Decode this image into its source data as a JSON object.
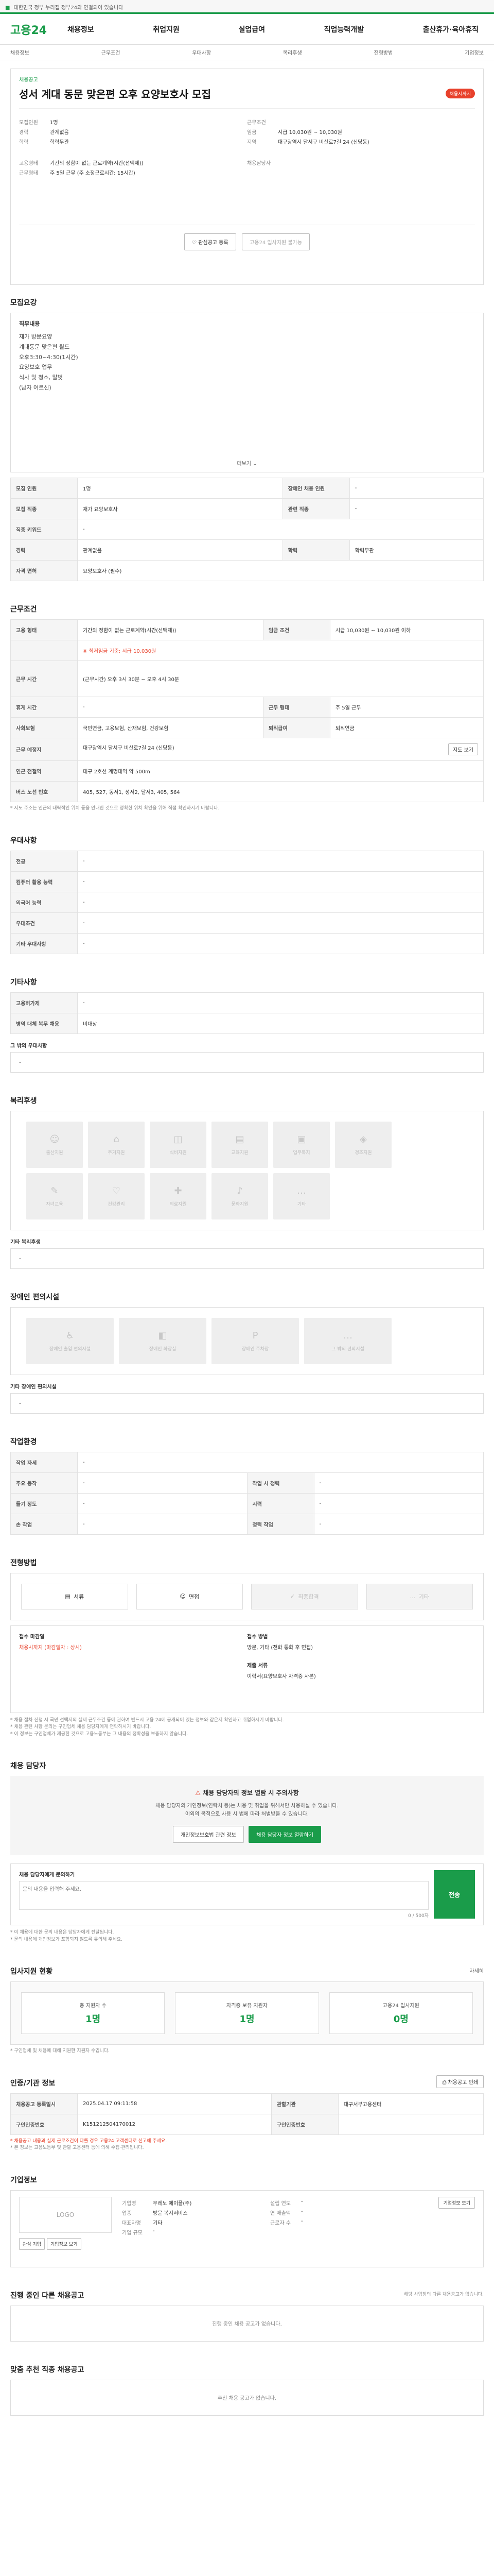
{
  "topbar": {
    "text": "대한민국 정부 누리집 정부24와 연결되어 있습니다"
  },
  "header": {
    "logo": "고용24",
    "nav": [
      "채용정보",
      "취업지원",
      "실업급여",
      "직업능력개발",
      "출산휴가·육아휴직"
    ]
  },
  "subnav": [
    "채용정보",
    "근무조건",
    "우대사항",
    "복리후생",
    "전형방법",
    "기업정보"
  ],
  "job": {
    "type_label": "채용공고",
    "title": "성서 계대 동문 맞은편 오후 요양보호사 모집",
    "status_badge": "채용시까지",
    "left": [
      {
        "k": "모집인원",
        "v": "1명"
      },
      {
        "k": "경력",
        "v": "관계없음"
      },
      {
        "k": "학력",
        "v": "학력무관"
      }
    ],
    "right": [
      {
        "k": "근무조건",
        "v": ""
      },
      {
        "k": "임금",
        "v": "시급 10,030원 ~ 10,030원"
      },
      {
        "k": "지역",
        "v": "대구광역시 달서구 비산로7길 24 (신당동)"
      }
    ],
    "employment": [
      {
        "k": "고용형태",
        "v": "기간의 정함이 없는 근로계약(시간(선택제))"
      },
      {
        "k": "근무형태",
        "v": "주 5일 근무 (주 소정근로시간: 15시간)"
      }
    ],
    "contact_label": "채용담당자",
    "interest_btn": "관심공고 등록",
    "share_btn": "고용24 입사지원 불가능"
  },
  "recruit": {
    "title": "모집요강",
    "desc_title": "직무내용",
    "desc_lines": [
      "재가 방문요양",
      "계대동문 맞은편 월드",
      "오후3:30~4:30(1시간)",
      "요양보호 업무",
      "식사 및 청소, 말벗",
      "(남자 어르신)"
    ],
    "more": "더보기",
    "rows": [
      {
        "k": "모집 인원",
        "v": "1명",
        "k2": "장애인 채용 인원",
        "v2": "-"
      },
      {
        "k": "모집 직종",
        "v": "재가 요양보호사",
        "k2": "관련 직종",
        "v2": "-"
      },
      {
        "k": "직종 키워드",
        "v": "-",
        "k2": "",
        "v2": ""
      },
      {
        "k": "경력",
        "v": "관계없음",
        "k2": "학력",
        "v2": "학력무관"
      },
      {
        "k": "자격 면허",
        "v": "요양보호사 (필수)",
        "k2": "",
        "v2": ""
      }
    ]
  },
  "conditions": {
    "title": "근무조건",
    "rows": [
      {
        "k": "고용 형태",
        "v": "기간의 정함이 없는 근로계약(시간(선택제))",
        "k2": "임금 조건",
        "v2": "시급 10,030원 ~ 10,030원 이하"
      },
      {
        "k": "",
        "v": "※ 최저임금 기준: 시급 10,030원",
        "k2": "",
        "v2": ""
      },
      {
        "k": "근무 시간",
        "v": "(근무시간) 오후 3시 30분 ~ 오후 4시 30분",
        "k2": "",
        "v2": ""
      },
      {
        "k": "휴게 시간",
        "v": "-",
        "k2": "근무 형태",
        "v2": "주 5일 근무"
      },
      {
        "k": "사회보험",
        "v": "국민연금, 고용보험, 산재보험, 건강보험",
        "k2": "퇴직급여",
        "v2": "퇴직연금"
      },
      {
        "k": "근무 예정지",
        "v": "대구광역시 달서구 비산로7길 24 (신당동)",
        "k2": "",
        "v2": ""
      },
      {
        "k": "인근 전철역",
        "v": "대구 2호선 계명대역 약 500m",
        "k2": "",
        "v2": ""
      },
      {
        "k": "버스 노선 번호",
        "v": "405, 527, 동서1, 성서2, 달서3, 405, 564",
        "k2": "",
        "v2": ""
      }
    ],
    "map_btn": "지도 보기",
    "note": "* 지도 주소는 인근의 대략적인 위치 등을 안내한 것으로 정확한 위치 확인을 위해 직접 확인하시기 바랍니다."
  },
  "preference": {
    "title": "우대사항",
    "rows": [
      {
        "k": "전공",
        "v": "-"
      },
      {
        "k": "컴퓨터 활용 능력",
        "v": "-"
      },
      {
        "k": "외국어 능력",
        "v": "-"
      },
      {
        "k": "우대조건",
        "v": "-"
      },
      {
        "k": "기타 우대사항",
        "v": "-"
      }
    ]
  },
  "etc": {
    "title": "기타사항",
    "rows": [
      {
        "k": "고용허가제",
        "v": "-"
      },
      {
        "k": "병역 대체 복무 채용",
        "v": "비대상"
      }
    ],
    "other_title": "그 밖의 우대사항",
    "other_value": "-"
  },
  "welfare": {
    "title": "복리후생",
    "items": [
      "출산지원",
      "주거지원",
      "식비지원",
      "교육지원",
      "업무복지",
      "경조지원",
      "자녀교육",
      "건강관리",
      "의료지원",
      "문화지원",
      "기타"
    ],
    "etc_title": "기타 복리후생",
    "etc_value": "-"
  },
  "disability": {
    "title": "장애인 편의시설",
    "items": [
      "장애인 출입 편의시설",
      "장애인 화장실",
      "장애인 주차장",
      "그 밖의 편의시설"
    ],
    "etc_title": "기타 장애인 편의시설",
    "etc_value": "-"
  },
  "workenv": {
    "title": "작업환경",
    "rows": [
      {
        "k": "작업 자세",
        "v": "-",
        "k2": "",
        "v2": ""
      },
      {
        "k": "주요 동작",
        "v": "-",
        "k2": "작업 시 청력",
        "v2": "-"
      },
      {
        "k": "들기 정도",
        "v": "-",
        "k2": "시력",
        "v2": "-"
      },
      {
        "k": "손 작업",
        "v": "-",
        "k2": "청력 작업",
        "v2": "-"
      }
    ]
  },
  "process": {
    "title": "전형방법",
    "steps": [
      "서류",
      "면접",
      "최종합격",
      "기타"
    ],
    "left": [
      {
        "k": "접수 마감일",
        "v": "채용시까지 (마감일자 : 상시)"
      }
    ],
    "right": [
      {
        "k": "접수 방법",
        "v": "방문, 기타 (전화 통화 후 면접)"
      },
      {
        "k": "제출 서류",
        "v": "이력서(요양보호사 자격증 사본)"
      }
    ],
    "notes": [
      "* 채용 절차 진행 시 국민 선택지의 실제 근무조건 등에 관하여 반드시 고용 24에 공개되어 있는 정보와 같은지 확인하고 취업하시기 바랍니다.",
      "* 채용 관련 사항 문의는 구인업체 채용 담당자에게 연락하시기 바랍니다.",
      "* 이 정보는 구인업체가 제공한 것으로 고용노동부는 그 내용의 정확성을 보증하지 않습니다."
    ]
  },
  "contact": {
    "title": "채용 담당자",
    "warn_title": "채용 담당자의 정보 열람 시 주의사항",
    "warn_lines": [
      "채용 담당자의 개인정보(연락처 등)는 채용 및 취업을 위해서만 사용하실 수 있습니다.",
      "이외의 목적으로 사용 시 법에 따라 처벌받을 수 있습니다."
    ],
    "btn_left": "개인정보보호법 관련 정보",
    "btn_right": "채용 담당자 정보 열람하기",
    "inquiry_title": "채용 담당자에게 문의하기",
    "inquiry_placeholder": "문의 내용을 입력해 주세요.",
    "inquiry_count": "0 / 500자",
    "inquiry_btn": "전송",
    "notes": [
      "* 이 채용에 대한 문의 내용은 담당자에게 전달됩니다.",
      "* 문의 내용에 개인정보가 포함되지 않도록 유의해 주세요."
    ]
  },
  "applicants": {
    "title": "입사지원 현황",
    "more": "자세히",
    "items": [
      {
        "label": "총 지원자 수",
        "value": "1명"
      },
      {
        "label": "자격증 보유 지원자",
        "value": "1명"
      },
      {
        "label": "고용24 입사지원",
        "value": "0명"
      }
    ],
    "note": "* 구인업체 및 채용에 대해 지원한 지원자 수입니다."
  },
  "manage": {
    "title": "인증/기관 정보",
    "print_btn": "채용공고 인쇄",
    "rows": [
      {
        "k": "채용공고 등록일시",
        "v": "2025.04.17 09:11:58",
        "k2": "관할기관",
        "v2": "대구서부고용센터"
      },
      {
        "k": "구인인증번호",
        "v": "K151212504170012",
        "k2": "구인인증번호 ",
        "v2": ""
      }
    ],
    "notes": [
      "* 채용공고 내용과 실제 근로조건이 다를 경우 고용24 고객센터로 신고해 주세요.",
      "* 본 정보는 고용노동부 및 관할 고용센터 등에 의해 수집·관리됩니다."
    ]
  },
  "company": {
    "title": "기업정보",
    "logo_label": "LOGO",
    "btn_interest": "관심 기업",
    "btn_info": "기업정보 보기",
    "left": [
      {
        "k": "기업명",
        "v": "우레노 에이플(주)"
      },
      {
        "k": "업종",
        "v": "방문 복지서비스"
      },
      {
        "k": "대표자명",
        "v": "기타"
      },
      {
        "k": "기업 규모",
        "v": "-"
      }
    ],
    "right": [
      {
        "k": "설립 연도",
        "v": "-"
      },
      {
        "k": "연 매출액",
        "v": "-"
      },
      {
        "k": "근로자 수",
        "v": "-"
      }
    ],
    "side_btn": "기업정보 보기"
  },
  "other_jobs": {
    "title": "진행 중인 다른 채용공고",
    "empty": "진행 중인 채용 공고가 없습니다.",
    "note": "해당 사업장의 다른 채용공고가 없습니다."
  },
  "recommend": {
    "title": "맞춤 추천 직종 채용공고",
    "empty": "추천 채용 공고가 없습니다."
  }
}
